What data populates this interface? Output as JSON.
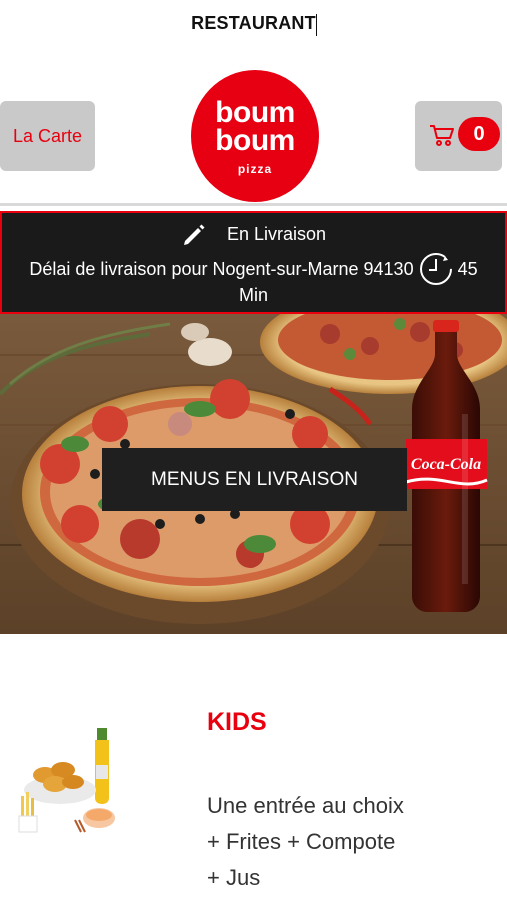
{
  "topbar": {
    "title": "RESTAURANT"
  },
  "header": {
    "carte_label": "La Carte",
    "logo": {
      "line1": "boum",
      "line2": "boum",
      "line3": "pizza"
    },
    "cart_count": "0"
  },
  "delivery": {
    "mode": "En Livraison",
    "delay_text": "Délai de livraison pour Nogent-sur-Marne 94130",
    "delay_value": "45",
    "delay_unit": "Min"
  },
  "hero": {
    "cta_label": "MENUS EN LIVRAISON",
    "bottle_brand": "Coca-Cola"
  },
  "products": [
    {
      "name": "KIDS",
      "description": "Une entrée au choix + Frites + Compote + Jus"
    }
  ],
  "colors": {
    "accent": "#e8000f",
    "dark": "#1a1a1a",
    "button_grey": "#c9c9c9"
  }
}
